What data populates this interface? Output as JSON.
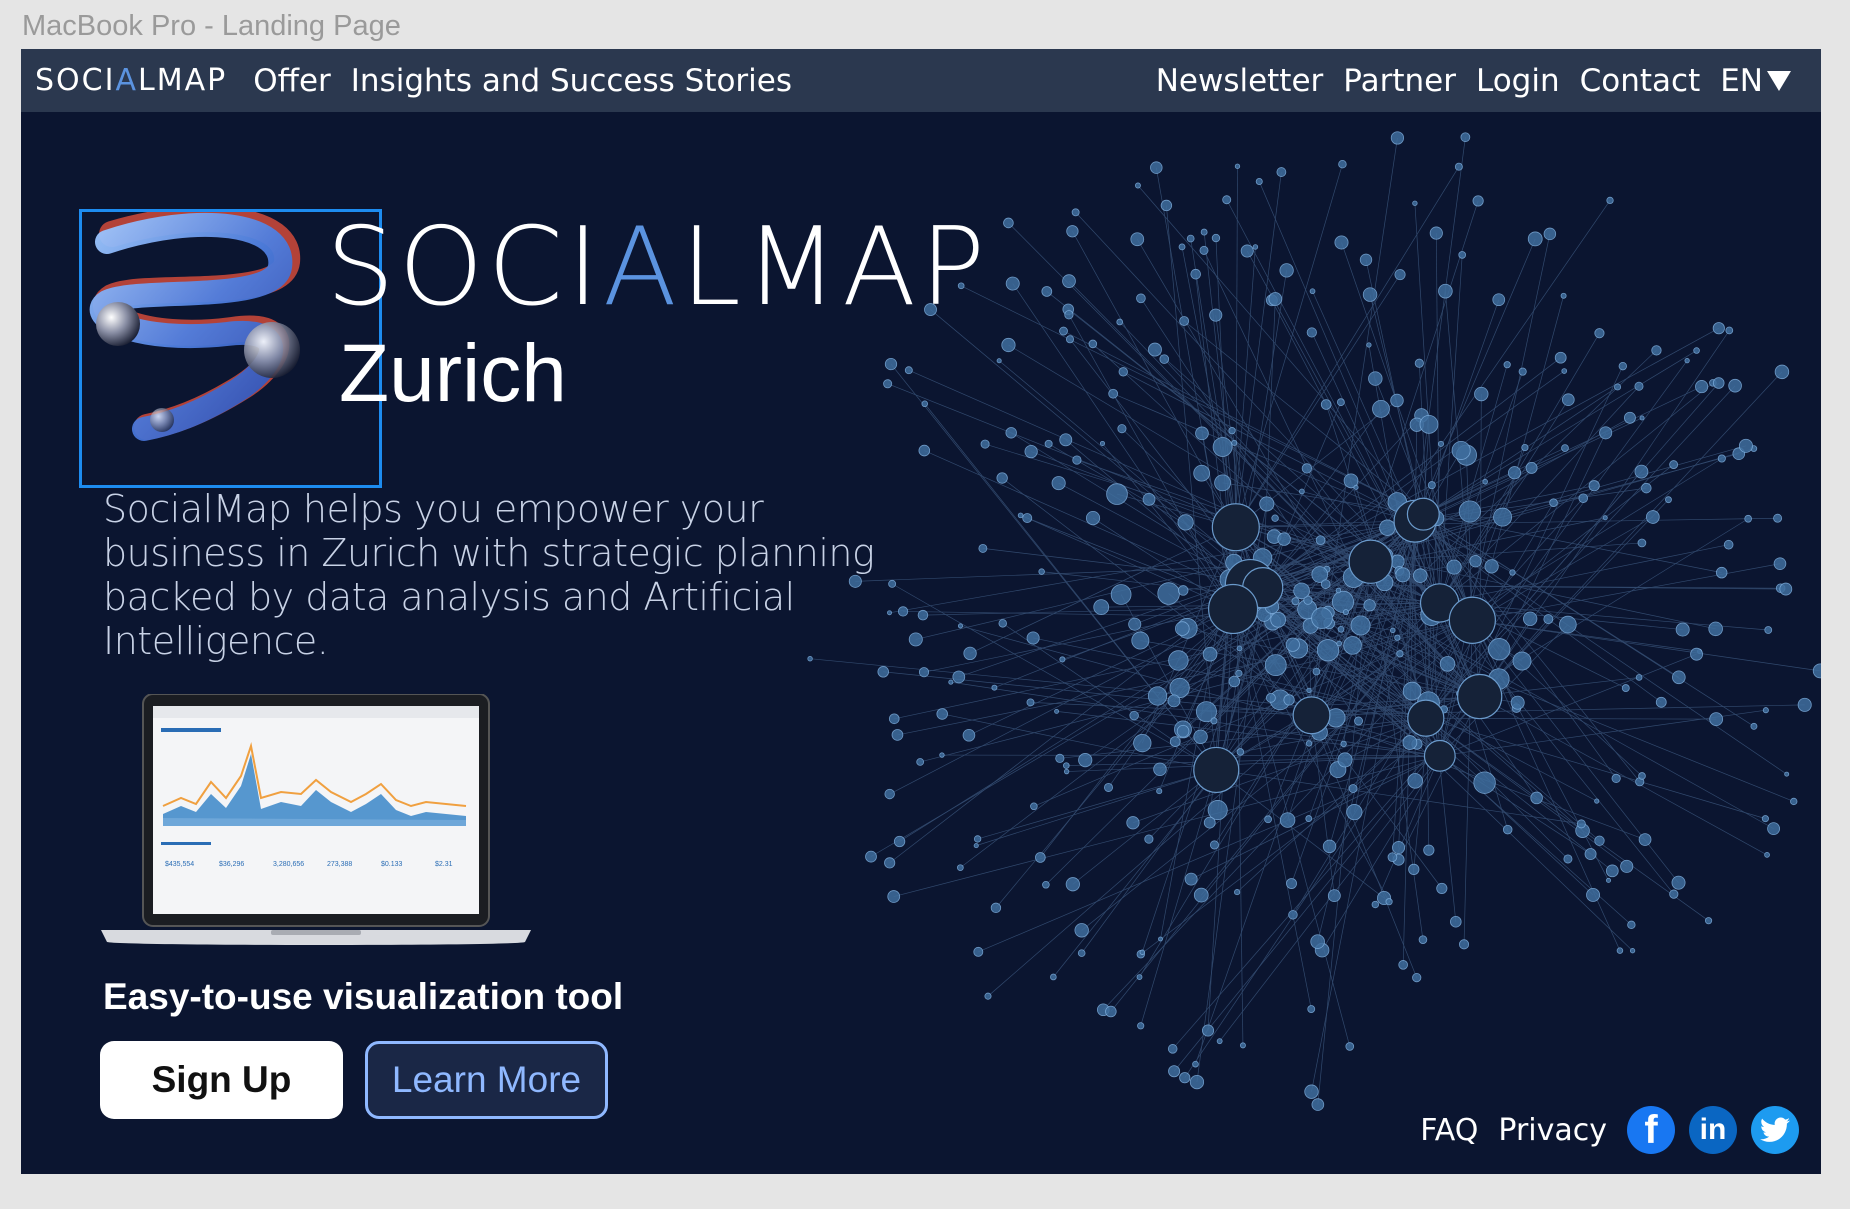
{
  "frame": {
    "label": "MacBook Pro - Landing Page"
  },
  "nav": {
    "logo_pre": "SOCI",
    "logo_accent": "A",
    "logo_post": "LMAP",
    "left_links": [
      "Offer",
      "Insights and Success Stories"
    ],
    "right_links": [
      "Newsletter",
      "Partner",
      "Login",
      "Contact"
    ],
    "language": "EN"
  },
  "hero": {
    "brand_pre": "SOCI",
    "brand_accent": "A",
    "brand_post": "LMAP",
    "city": "Zurich",
    "description": "SocialMap helps you empower your business in Zurich with strategic planning backed by data analysis and Artificial Intelligence.",
    "tagline": "Easy-to-use visualization tool",
    "signup_label": "Sign Up",
    "learn_more_label": "Learn More"
  },
  "footer": {
    "faq": "FAQ",
    "privacy": "Privacy",
    "social": [
      "facebook-icon",
      "linkedin-icon",
      "twitter-icon"
    ],
    "fb_glyph": "f",
    "li_glyph": "in"
  },
  "colors": {
    "background": "#0b1530",
    "navbar": "#2b384f",
    "accent": "#5b93e0",
    "selection": "#1d8cf0",
    "button_outline": "#8fb8ff"
  }
}
